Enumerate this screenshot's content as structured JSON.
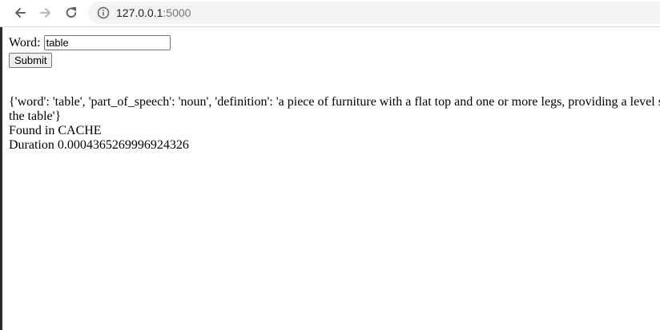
{
  "browser": {
    "url_host": "127.0.0.1",
    "url_port": ":5000",
    "icons": {
      "back": "back-arrow-icon",
      "forward": "forward-arrow-icon",
      "reload": "reload-icon",
      "info": "info-icon"
    }
  },
  "form": {
    "word_label": "Word:",
    "word_value": "table",
    "submit_label": "Submit"
  },
  "result": {
    "dict_line_1": "{'word': 'table', 'part_of_speech': 'noun', 'definition': 'a piece of furniture with a flat top and one or more legs, providing a level s",
    "dict_line_2": "the table'}",
    "found_text": "Found in CACHE",
    "duration_text": "Duration 0.0004365269996924326"
  },
  "colors": {
    "omnibox_bg": "#f1f3f4",
    "icon_color": "#5f6368",
    "port_color": "#70757a"
  }
}
